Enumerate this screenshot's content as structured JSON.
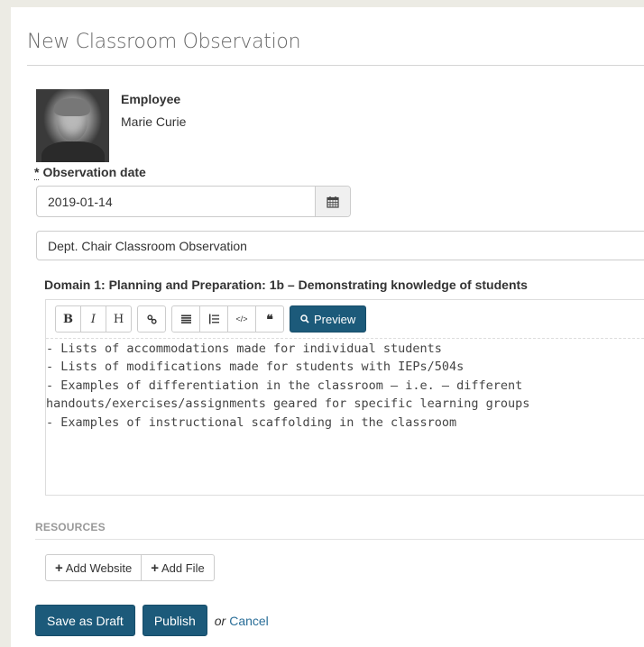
{
  "page": {
    "title": "New Classroom Observation"
  },
  "employee": {
    "label": "Employee",
    "name": "Marie Curie",
    "photo_icon": "employee-photo"
  },
  "observation_date": {
    "required_marker": "*",
    "label": "Observation date",
    "value": "2019-01-14",
    "calendar_icon": "calendar-icon"
  },
  "observation_type": {
    "value": "Dept. Chair Classroom Observation"
  },
  "domain": {
    "label": "Domain 1: Planning and Preparation: 1b – Demonstrating knowledge of students"
  },
  "editor": {
    "toolbar": {
      "bold": "B",
      "italic": "I",
      "heading": "H",
      "link_icon": "link-icon",
      "bullet_list_icon": "bullet-list-icon",
      "numbered_list_icon": "numbered-list-icon",
      "code_icon": "code-icon",
      "quote_icon": "quote-icon",
      "code_label": "</>",
      "quote_label": "❝",
      "preview_label": "Preview"
    },
    "content": "- Lists of accommodations made for individual students\n- Lists of modifications made for students with IEPs/504s\n- Examples of differentiation in the classroom – i.e. – different handouts/exercises/assignments geared for specific learning groups\n- Examples of instructional scaffolding in the classroom"
  },
  "resources": {
    "label": "RESOURCES",
    "add_website": "Add Website",
    "add_file": "Add File",
    "plus": "+"
  },
  "actions": {
    "save_draft": "Save as Draft",
    "publish": "Publish",
    "or": "or",
    "cancel": "Cancel"
  },
  "colors": {
    "primary": "#1c5a7a",
    "link": "#2a6e98",
    "page_background": "#ecebe4"
  }
}
